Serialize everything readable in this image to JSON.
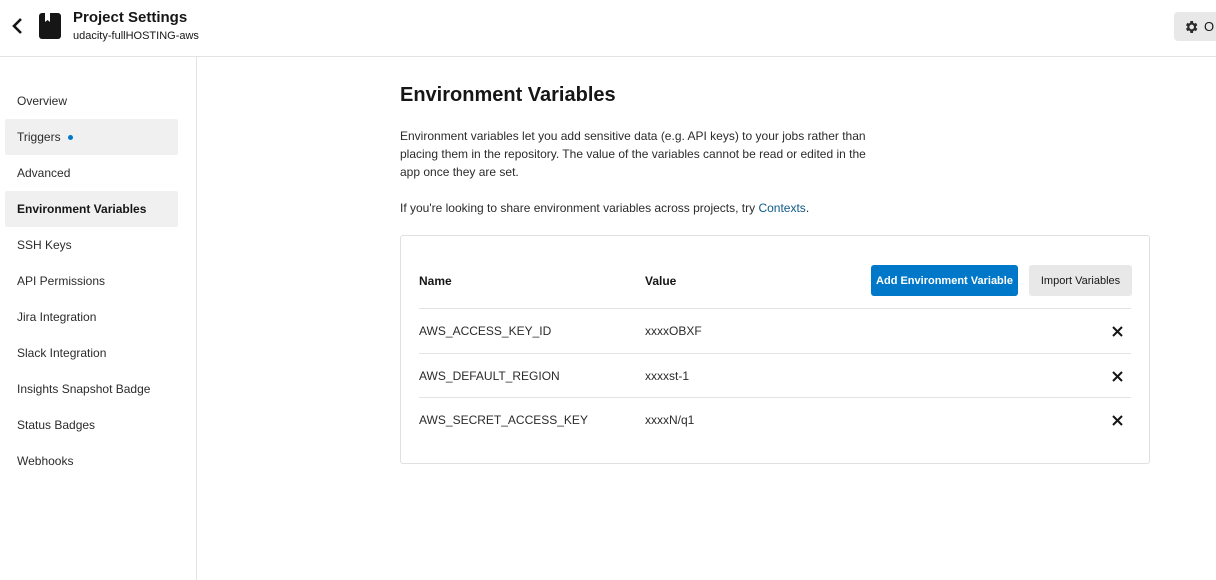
{
  "header": {
    "title": "Project Settings",
    "subtitle": "udacity-fullHOSTING-aws",
    "settings_label": "O"
  },
  "sidebar": {
    "items": [
      {
        "label": "Overview",
        "state": "normal"
      },
      {
        "label": "Triggers",
        "state": "highlight",
        "dot": true
      },
      {
        "label": "Advanced",
        "state": "normal"
      },
      {
        "label": "Environment Variables",
        "state": "active"
      },
      {
        "label": "SSH Keys",
        "state": "normal"
      },
      {
        "label": "API Permissions",
        "state": "normal"
      },
      {
        "label": "Jira Integration",
        "state": "normal"
      },
      {
        "label": "Slack Integration",
        "state": "normal"
      },
      {
        "label": "Insights Snapshot Badge",
        "state": "normal"
      },
      {
        "label": "Status Badges",
        "state": "normal"
      },
      {
        "label": "Webhooks",
        "state": "normal"
      }
    ]
  },
  "main": {
    "title": "Environment Variables",
    "description": "Environment variables let you add sensitive data (e.g. API keys) to your jobs rather than placing them in the repository. The value of the variables cannot be read or edited in the app once they are set.",
    "share_prefix": "If you're looking to share environment variables across projects, try ",
    "share_link": "Contexts",
    "share_suffix": ".",
    "table": {
      "col_name": "Name",
      "col_value": "Value",
      "add_button": "Add Environment Variable",
      "import_button": "Import Variables",
      "rows": [
        {
          "name": "AWS_ACCESS_KEY_ID",
          "value": "xxxxOBXF"
        },
        {
          "name": "AWS_DEFAULT_REGION",
          "value": "xxxxst-1"
        },
        {
          "name": "AWS_SECRET_ACCESS_KEY",
          "value": "xxxxN/q1"
        }
      ]
    }
  },
  "colors": {
    "accent": "#0078ca",
    "link": "#0e5a8a",
    "active_bg": "#f0f0f0"
  },
  "icons": {
    "back": "chevron-left-icon",
    "project": "book-icon",
    "settings": "gear-icon",
    "delete": "close-icon"
  }
}
